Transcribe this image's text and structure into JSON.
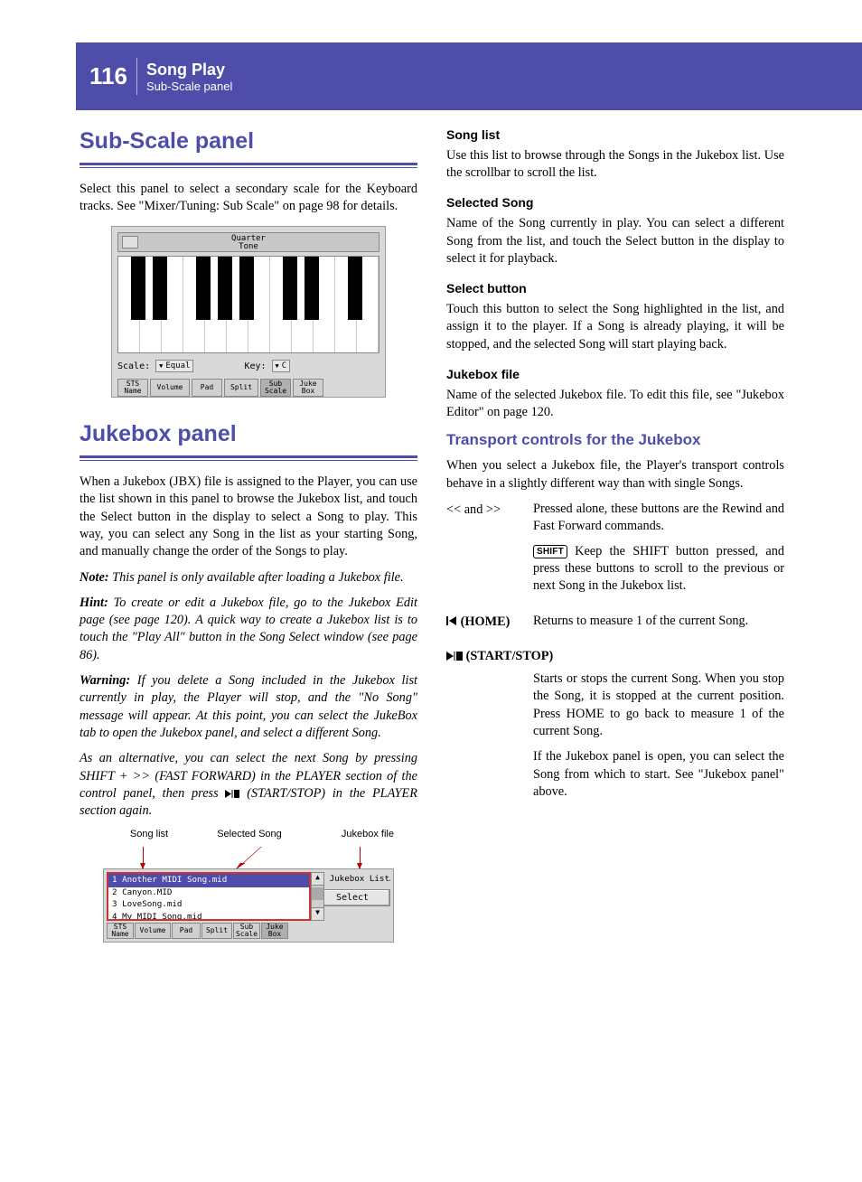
{
  "header": {
    "page_number": "116",
    "title": "Song Play",
    "subtitle": "Sub-Scale panel"
  },
  "left": {
    "h1a": "Sub-Scale panel",
    "p1": "Select this panel to select a secondary scale for the Keyboard tracks. See \"Mixer/Tuning: Sub Scale\" on page 98 for details.",
    "fig1": {
      "quarter_tone": "Quarter\nTone",
      "scale_label": "Scale:",
      "scale_value": "Equal",
      "key_label": "Key:",
      "key_value": "C",
      "tabs": [
        "STS\nName",
        "Volume",
        "Pad",
        "Split",
        "Sub\nScale",
        "Juke\nBox"
      ]
    },
    "h1b": "Jukebox panel",
    "p2": "When a Jukebox (JBX) file is assigned to the Player, you can use the list shown in this panel to browse the Jukebox list, and touch the Select button in the display to select a Song to play. This way, you can select any Song in the list as your starting Song, and manually change the order of the Songs to play.",
    "note_label": "Note:",
    "note_body": " This panel is only available after loading a Jukebox file.",
    "hint_label": "Hint:",
    "hint_body": " To create or edit a Jukebox file, go to the Jukebox Edit page (see page 120). A quick way to create a Jukebox list is to touch the \"Play All\" button in the Song Select window (see page 86).",
    "warn_label": "Warning:",
    "warn_body": " If you delete a Song included in the Jukebox list currently in play, the Player will stop, and the \"No Song\" message will appear. At this point, you can select the JukeBox tab to open the Jukebox panel, and select a different Song.",
    "alt_a": "As an alternative, you can select the next Song by pressing SHIFT + >> (FAST FORWARD) in the PLAYER section of the control panel, then press ",
    "alt_b": " (START/STOP) in the PLAYER section again.",
    "fig2_labels": {
      "a": "Song list",
      "b": "Selected Song",
      "c": "Jukebox file"
    },
    "fig2": {
      "rows": [
        "1  Another MIDI Song.mid",
        "2  Canyon.MID",
        "3  LoveSong.mid",
        "4  My MIDI Song.mid"
      ],
      "jbx": "My Jukebox List…",
      "select": "Select",
      "tabs": [
        "STS\nName",
        "Volume",
        "Pad",
        "Split",
        "Sub\nScale",
        "Juke\nBox"
      ]
    }
  },
  "right": {
    "h_songlist": "Song list",
    "p_songlist": "Use this list to browse through the Songs in the Jukebox list. Use the scrollbar to scroll the list.",
    "h_selected": "Selected Song",
    "p_selected": "Name of the Song currently in play. You can select a different Song from the list, and touch the Select button in the display to select it for playback.",
    "h_selbtn": "Select button",
    "p_selbtn": "Touch this button to select the Song highlighted in the list, and assign it to the player. If a Song is already playing, it will be stopped, and the selected Song will start playing back.",
    "h_jbx": "Jukebox file",
    "p_jbx": "Name of the selected Jukebox file. To edit this file, see \"Jukebox Editor\" on page 120.",
    "h2_transport": "Transport controls for the Jukebox",
    "p_transport": "When you select a Jukebox file, the Player's transport controls behave in a slightly different way than with single Songs.",
    "d1_term": "<< and >>",
    "d1_body": "Pressed alone, these buttons are the Rewind and Fast Forward commands.",
    "d1_shift": "SHIFT",
    "d1_shiftbody": " Keep the SHIFT button pressed, and press these buttons to scroll to the previous or next Song in the Jukebox list.",
    "d2_term": "(HOME)",
    "d2_body": "Returns to measure 1 of the current Song.",
    "d3_term": "(START/STOP)",
    "d3_body1": "Starts or stops the current Song. When you stop the Song, it is stopped at the current position. Press HOME to go back to measure 1 of the current Song.",
    "d3_body2": "If the Jukebox panel is open, you can select the Song from which to start. See \"Jukebox panel\" above."
  }
}
